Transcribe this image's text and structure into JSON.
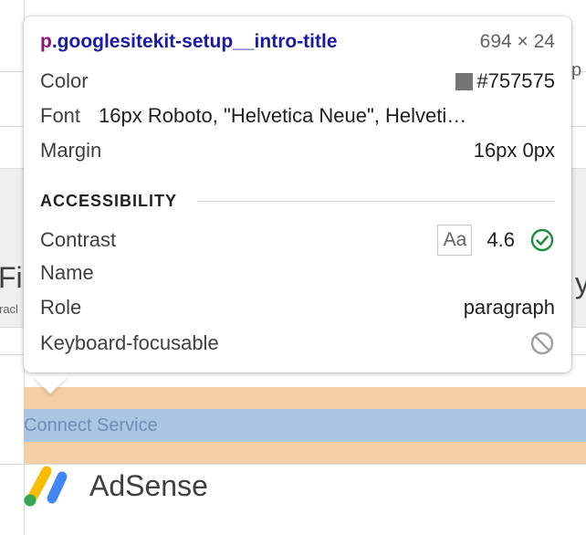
{
  "tooltip": {
    "title": {
      "tag": "p",
      "class": ".googlesitekit-setup__intro-title",
      "dims": "694 × 24"
    },
    "properties": {
      "color_label": "Color",
      "color_value": "#757575",
      "font_label": "Font",
      "font_value": "16px Roboto, \"Helvetica Neue\", Helveti…",
      "margin_label": "Margin",
      "margin_value": "16px 0px"
    },
    "accessibility": {
      "header": "ACCESSIBILITY",
      "contrast_label": "Contrast",
      "contrast_badge": "Aa",
      "contrast_value": "4.6",
      "contrast_icon": "check-circle-icon",
      "name_label": "Name",
      "role_label": "Role",
      "role_value": "paragraph",
      "keyboard_label": "Keyboard-focusable",
      "keyboard_icon": "not-allowed-icon"
    }
  },
  "background": {
    "heading_fragment": "Fi",
    "subtext_fragment": "racl",
    "right_fragment": "y",
    "top_right_fragment": "p",
    "connect_service": "Connect Service",
    "service_name": "AdSense"
  },
  "colors": {
    "swatch": "#757575",
    "tag": "#881280",
    "selector": "#1a1aa6",
    "success": "#1e8e3e",
    "margin_highlight": "#f4cfa4",
    "content_highlight": "#a9c6e4"
  }
}
